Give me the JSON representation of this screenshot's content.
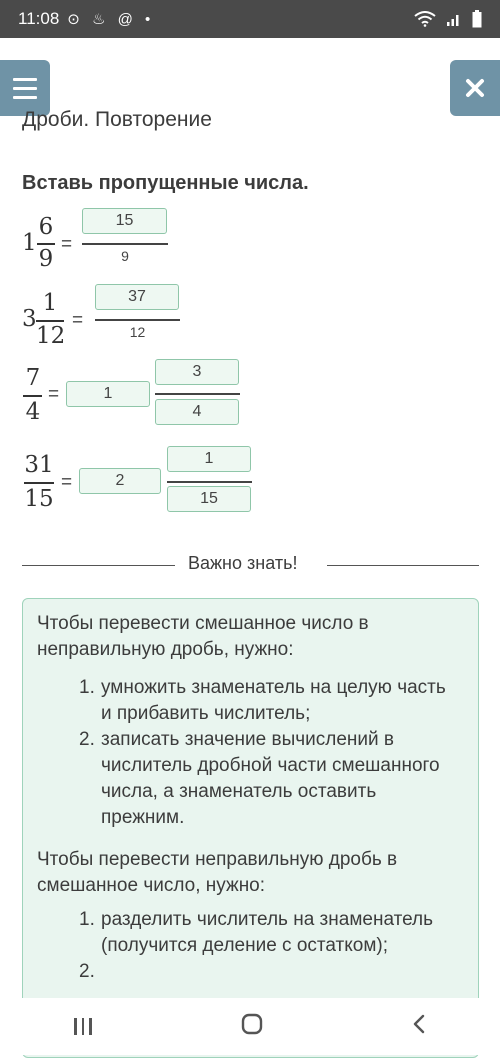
{
  "status": {
    "time": "11:08",
    "notif_icons": "⊙ ♨ @ •"
  },
  "page_title": "Дроби. Повторение",
  "task_title": "Вставь пропущенные числа.",
  "rows": [
    {
      "whole": "1",
      "num": "6",
      "den": "9",
      "answer_num": "15",
      "answer_den": "9"
    },
    {
      "whole": "3",
      "num": "1",
      "den": "12",
      "answer_num": "37",
      "answer_den": "12"
    },
    {
      "num": "7",
      "den": "4",
      "answer_whole": "1",
      "answer_num": "3",
      "answer_den": "4"
    },
    {
      "num": "31",
      "den": "15",
      "answer_whole": "2",
      "answer_num": "1",
      "answer_den": "15"
    }
  ],
  "equals": "=",
  "divider_label": "Важно знать!",
  "info": {
    "p1": "Чтобы перевести смешанное число в неправильную дробь, нужно:",
    "list1": [
      {
        "n": "1.",
        "text": "умножить знаменатель на целую часть и прибавить числитель;"
      },
      {
        "n": "2.",
        "text": "записать значение вычислений в числитель дробной части смешанного числа, а знаменатель оставить прежним."
      }
    ],
    "p2": "Чтобы перевести неправильную дробь в смешанное число, нужно:",
    "list2": [
      {
        "n": "1.",
        "text": "разделить числитель на знаменатель (получится деление с остатком);"
      },
      {
        "n": "2.",
        "text": ""
      }
    ]
  },
  "colors": {
    "statusbar": "#4a4a4a",
    "header_button": "#6f93a6",
    "answer_border": "#8fc6a9",
    "answer_fill": "#eef8f2",
    "info_fill": "#e9f5ef",
    "info_border": "#9fd3bb"
  },
  "icons": [
    "whatsapp-icon",
    "notification-icon",
    "at-icon",
    "wifi-icon",
    "signal-icon",
    "battery-icon",
    "menu-icon",
    "close-icon",
    "recent-apps-icon",
    "home-icon",
    "back-icon"
  ]
}
